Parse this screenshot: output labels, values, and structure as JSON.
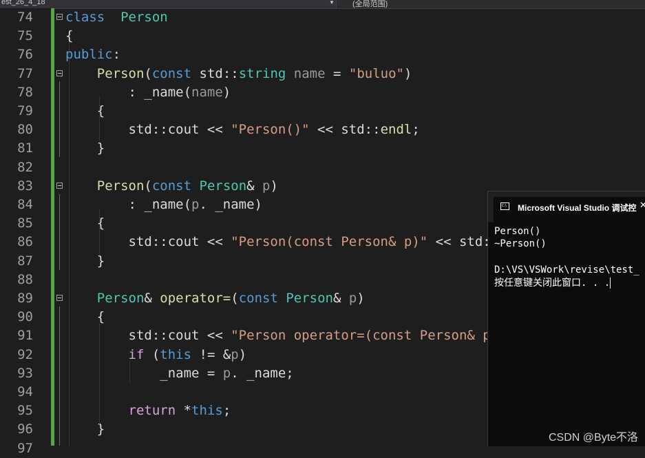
{
  "toolbar": {
    "left_scope": "est_26_4_18",
    "right_scope": "(全局范围)"
  },
  "editor": {
    "lines": [
      {
        "n": "74",
        "segs": [
          [
            "kw",
            "class"
          ],
          [
            "",
            "  "
          ],
          [
            "ty",
            "Person"
          ]
        ]
      },
      {
        "n": "75",
        "segs": [
          [
            "",
            "{"
          ]
        ]
      },
      {
        "n": "76",
        "segs": [
          [
            "kw",
            "public"
          ],
          [
            "",
            ":"
          ]
        ]
      },
      {
        "n": "77",
        "segs": [
          [
            "",
            "    "
          ],
          [
            "fn",
            "Person"
          ],
          [
            "",
            "("
          ],
          [
            "kw",
            "const"
          ],
          [
            "",
            " std::"
          ],
          [
            "ty",
            "string"
          ],
          [
            "",
            " "
          ],
          [
            "par",
            "name"
          ],
          [
            "",
            " = "
          ],
          [
            "str",
            "\"buluo\""
          ],
          [
            "",
            ")"
          ]
        ]
      },
      {
        "n": "78",
        "segs": [
          [
            "",
            "        : _name("
          ],
          [
            "par",
            "name"
          ],
          [
            "",
            ")"
          ]
        ]
      },
      {
        "n": "79",
        "segs": [
          [
            "",
            "    {"
          ]
        ]
      },
      {
        "n": "80",
        "segs": [
          [
            "",
            "        std::cout << "
          ],
          [
            "str",
            "\"Person()\""
          ],
          [
            "",
            " << std::"
          ],
          [
            "fn",
            "endl"
          ],
          [
            "",
            ";"
          ]
        ]
      },
      {
        "n": "81",
        "segs": [
          [
            "",
            "    }"
          ]
        ]
      },
      {
        "n": "82",
        "segs": []
      },
      {
        "n": "83",
        "segs": [
          [
            "",
            "    "
          ],
          [
            "fn",
            "Person"
          ],
          [
            "",
            "("
          ],
          [
            "kw",
            "const"
          ],
          [
            "",
            " "
          ],
          [
            "ty",
            "Person"
          ],
          [
            "",
            "& "
          ],
          [
            "par",
            "p"
          ],
          [
            "",
            ")"
          ]
        ]
      },
      {
        "n": "84",
        "segs": [
          [
            "",
            "        : _name("
          ],
          [
            "par",
            "p"
          ],
          [
            "",
            ". _name)"
          ]
        ]
      },
      {
        "n": "85",
        "segs": [
          [
            "",
            "    {"
          ]
        ]
      },
      {
        "n": "86",
        "segs": [
          [
            "",
            "        std::cout << "
          ],
          [
            "str",
            "\"Person(const Person& p)\""
          ],
          [
            "",
            " << std::"
          ]
        ]
      },
      {
        "n": "87",
        "segs": [
          [
            "",
            "    }"
          ]
        ]
      },
      {
        "n": "88",
        "segs": []
      },
      {
        "n": "89",
        "segs": [
          [
            "",
            "    "
          ],
          [
            "ty",
            "Person"
          ],
          [
            "",
            "& "
          ],
          [
            "fn",
            "operator="
          ],
          [
            "",
            "("
          ],
          [
            "kw",
            "const"
          ],
          [
            "",
            " "
          ],
          [
            "ty",
            "Person"
          ],
          [
            "",
            "& "
          ],
          [
            "par",
            "p"
          ],
          [
            "",
            ")"
          ]
        ]
      },
      {
        "n": "90",
        "segs": [
          [
            "",
            "    {"
          ]
        ]
      },
      {
        "n": "91",
        "segs": [
          [
            "",
            "        std::cout << "
          ],
          [
            "str",
            "\"Person operator=(const Person& p)"
          ]
        ]
      },
      {
        "n": "92",
        "segs": [
          [
            "",
            "        "
          ],
          [
            "ctl",
            "if"
          ],
          [
            "",
            " ("
          ],
          [
            "kw",
            "this"
          ],
          [
            "",
            " != &"
          ],
          [
            "par",
            "p"
          ],
          [
            "",
            ")"
          ]
        ]
      },
      {
        "n": "93",
        "segs": [
          [
            "",
            "            _name = "
          ],
          [
            "par",
            "p"
          ],
          [
            "",
            ". _name;"
          ]
        ]
      },
      {
        "n": "94",
        "segs": []
      },
      {
        "n": "95",
        "segs": [
          [
            "",
            "        "
          ],
          [
            "ctl",
            "return"
          ],
          [
            "",
            " *"
          ],
          [
            "kw",
            "this"
          ],
          [
            "",
            ";"
          ]
        ]
      },
      {
        "n": "96",
        "segs": [
          [
            "",
            "    }"
          ]
        ]
      },
      {
        "n": "97",
        "segs": []
      }
    ]
  },
  "console": {
    "title": "Microsoft Visual Studio 调试控",
    "icon_text": "C:\\",
    "close": "✕",
    "output": [
      "Person()",
      "~Person()",
      "",
      "D:\\VS\\VSWork\\revise\\test_",
      "按任意键关闭此窗口. . ."
    ]
  },
  "watermark": "CSDN @Byte不洛"
}
